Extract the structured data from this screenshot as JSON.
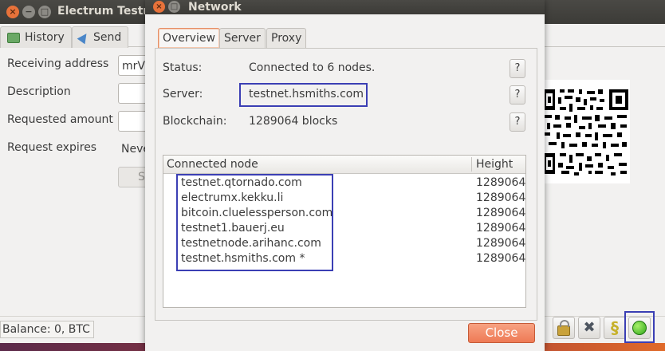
{
  "main_window": {
    "title": "Electrum Testn",
    "tabs": [
      {
        "label": "History"
      },
      {
        "label": "Send"
      }
    ],
    "form": {
      "receiving_address_label": "Receiving address",
      "receiving_address_value": "mrV",
      "description_label": "Description",
      "requested_amount_label": "Requested amount",
      "request_expires_label": "Request expires",
      "request_expires_value": "Neve",
      "save_button_partial": "S"
    },
    "status_bar": {
      "balance": "Balance: 0, BTC",
      "icons": [
        "lock-icon",
        "preferences-icon",
        "seed-icon",
        "network-status-icon"
      ],
      "network_status_color": "#2fa81a"
    }
  },
  "dialog": {
    "title": "Network",
    "tabs": [
      {
        "label": "Overview",
        "active": true
      },
      {
        "label": "Server",
        "active": false
      },
      {
        "label": "Proxy",
        "active": false
      }
    ],
    "status_label": "Status:",
    "status_value": "Connected to 6 nodes.",
    "server_label": "Server:",
    "server_value": "testnet.hsmiths.com",
    "blockchain_label": "Blockchain:",
    "blockchain_value": "1289064 blocks",
    "help_label": "?",
    "nodes_table": {
      "columns": [
        "Connected node",
        "Height"
      ],
      "rows": [
        {
          "node": "testnet.qtornado.com",
          "height": "1289064"
        },
        {
          "node": "electrumx.kekku.li",
          "height": "1289064"
        },
        {
          "node": "bitcoin.cluelessperson.com",
          "height": "1289064"
        },
        {
          "node": "testnet1.bauerj.eu",
          "height": "1289064"
        },
        {
          "node": "testnetnode.arihanc.com",
          "height": "1289064"
        },
        {
          "node": "testnet.hsmiths.com *",
          "height": "1289064"
        }
      ]
    },
    "close_label": "Close",
    "accent_color": "#ee7a55"
  }
}
